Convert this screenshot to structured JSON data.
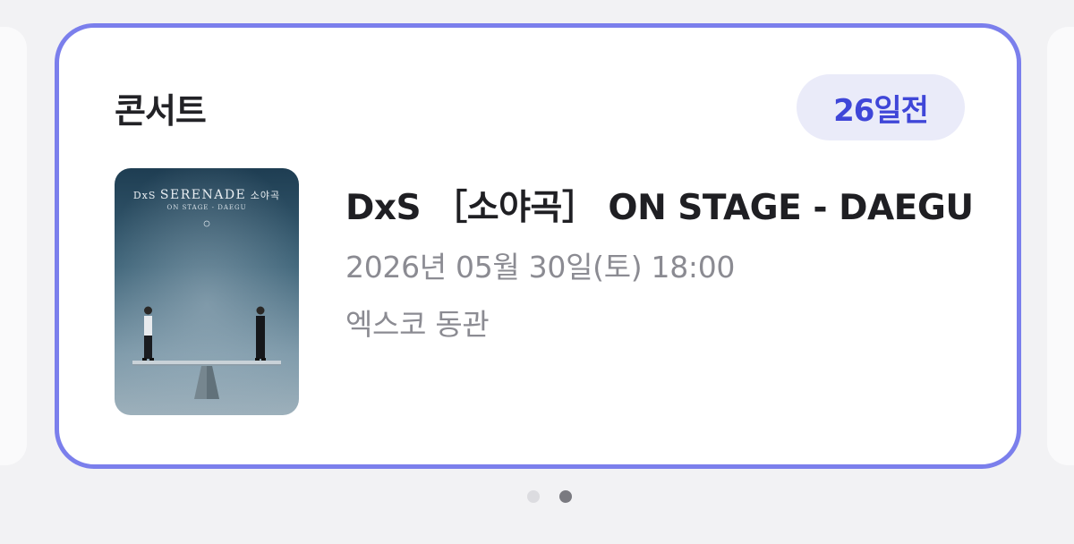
{
  "card": {
    "category": "콘서트",
    "dday": "26일전",
    "accent_color": "#7b7fec",
    "badge_text_color": "#3f46d8",
    "event": {
      "title": "DxS ［소야곡］ ON STAGE - DAEGU",
      "datetime": "2026년 05월 30일(토) 18:00",
      "venue": "엑스코 동관"
    },
    "poster": {
      "brand": "DxS",
      "title": "SERENADE",
      "korean_title": "소야곡",
      "subtitle": "ON STAGE - DAEGU"
    }
  },
  "pager": {
    "pages": 2,
    "active_index": 1
  }
}
